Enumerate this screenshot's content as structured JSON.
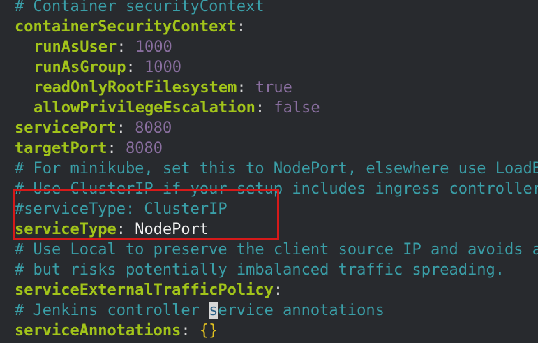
{
  "lines": [
    {
      "comment": "# Container securityContext"
    },
    {
      "key": "containerSecurityContext",
      "sep": ":"
    },
    {
      "key": "runAsUser",
      "sep": ": ",
      "value": "1000"
    },
    {
      "key": "runAsGroup",
      "sep": ": ",
      "value": "1000"
    },
    {
      "key": "readOnlyRootFilesystem",
      "sep": ": ",
      "value": "true"
    },
    {
      "key": "allowPrivilegeEscalation",
      "sep": ": ",
      "value": "false"
    },
    {
      "key": "servicePort",
      "sep": ": ",
      "value": "8080"
    },
    {
      "key": "targetPort",
      "sep": ": ",
      "value": "8080"
    },
    {
      "comment": "# For minikube, set this to NodePort, elsewhere use LoadBalancer"
    },
    {
      "comment": "# Use ClusterIP if your setup includes ingress controller"
    },
    {
      "comment": "#serviceType: ClusterIP"
    },
    {
      "key": "serviceType",
      "sep": ": ",
      "value": "NodePort"
    },
    {
      "comment": "# Use Local to preserve the client source IP and avoids a second hop for LoadBalancer and Nodeport type services,"
    },
    {
      "comment": "# but risks potentially imbalanced traffic spreading."
    },
    {
      "key": "serviceExternalTrafficPolicy",
      "sep": ":"
    },
    {
      "comment_pre": "# Jenkins controller ",
      "cursor_char": "s",
      "comment_post": "ervice annotations"
    },
    {
      "key": "serviceAnnotations",
      "sep": ": ",
      "value": "{}"
    }
  ],
  "colors": {
    "background": "#282a2e",
    "comment": "#3a9fa8",
    "key": "#a2c41a",
    "number": "#8a6fa0",
    "string": "#f0f0f0",
    "highlight_box": "#d61a1a"
  }
}
